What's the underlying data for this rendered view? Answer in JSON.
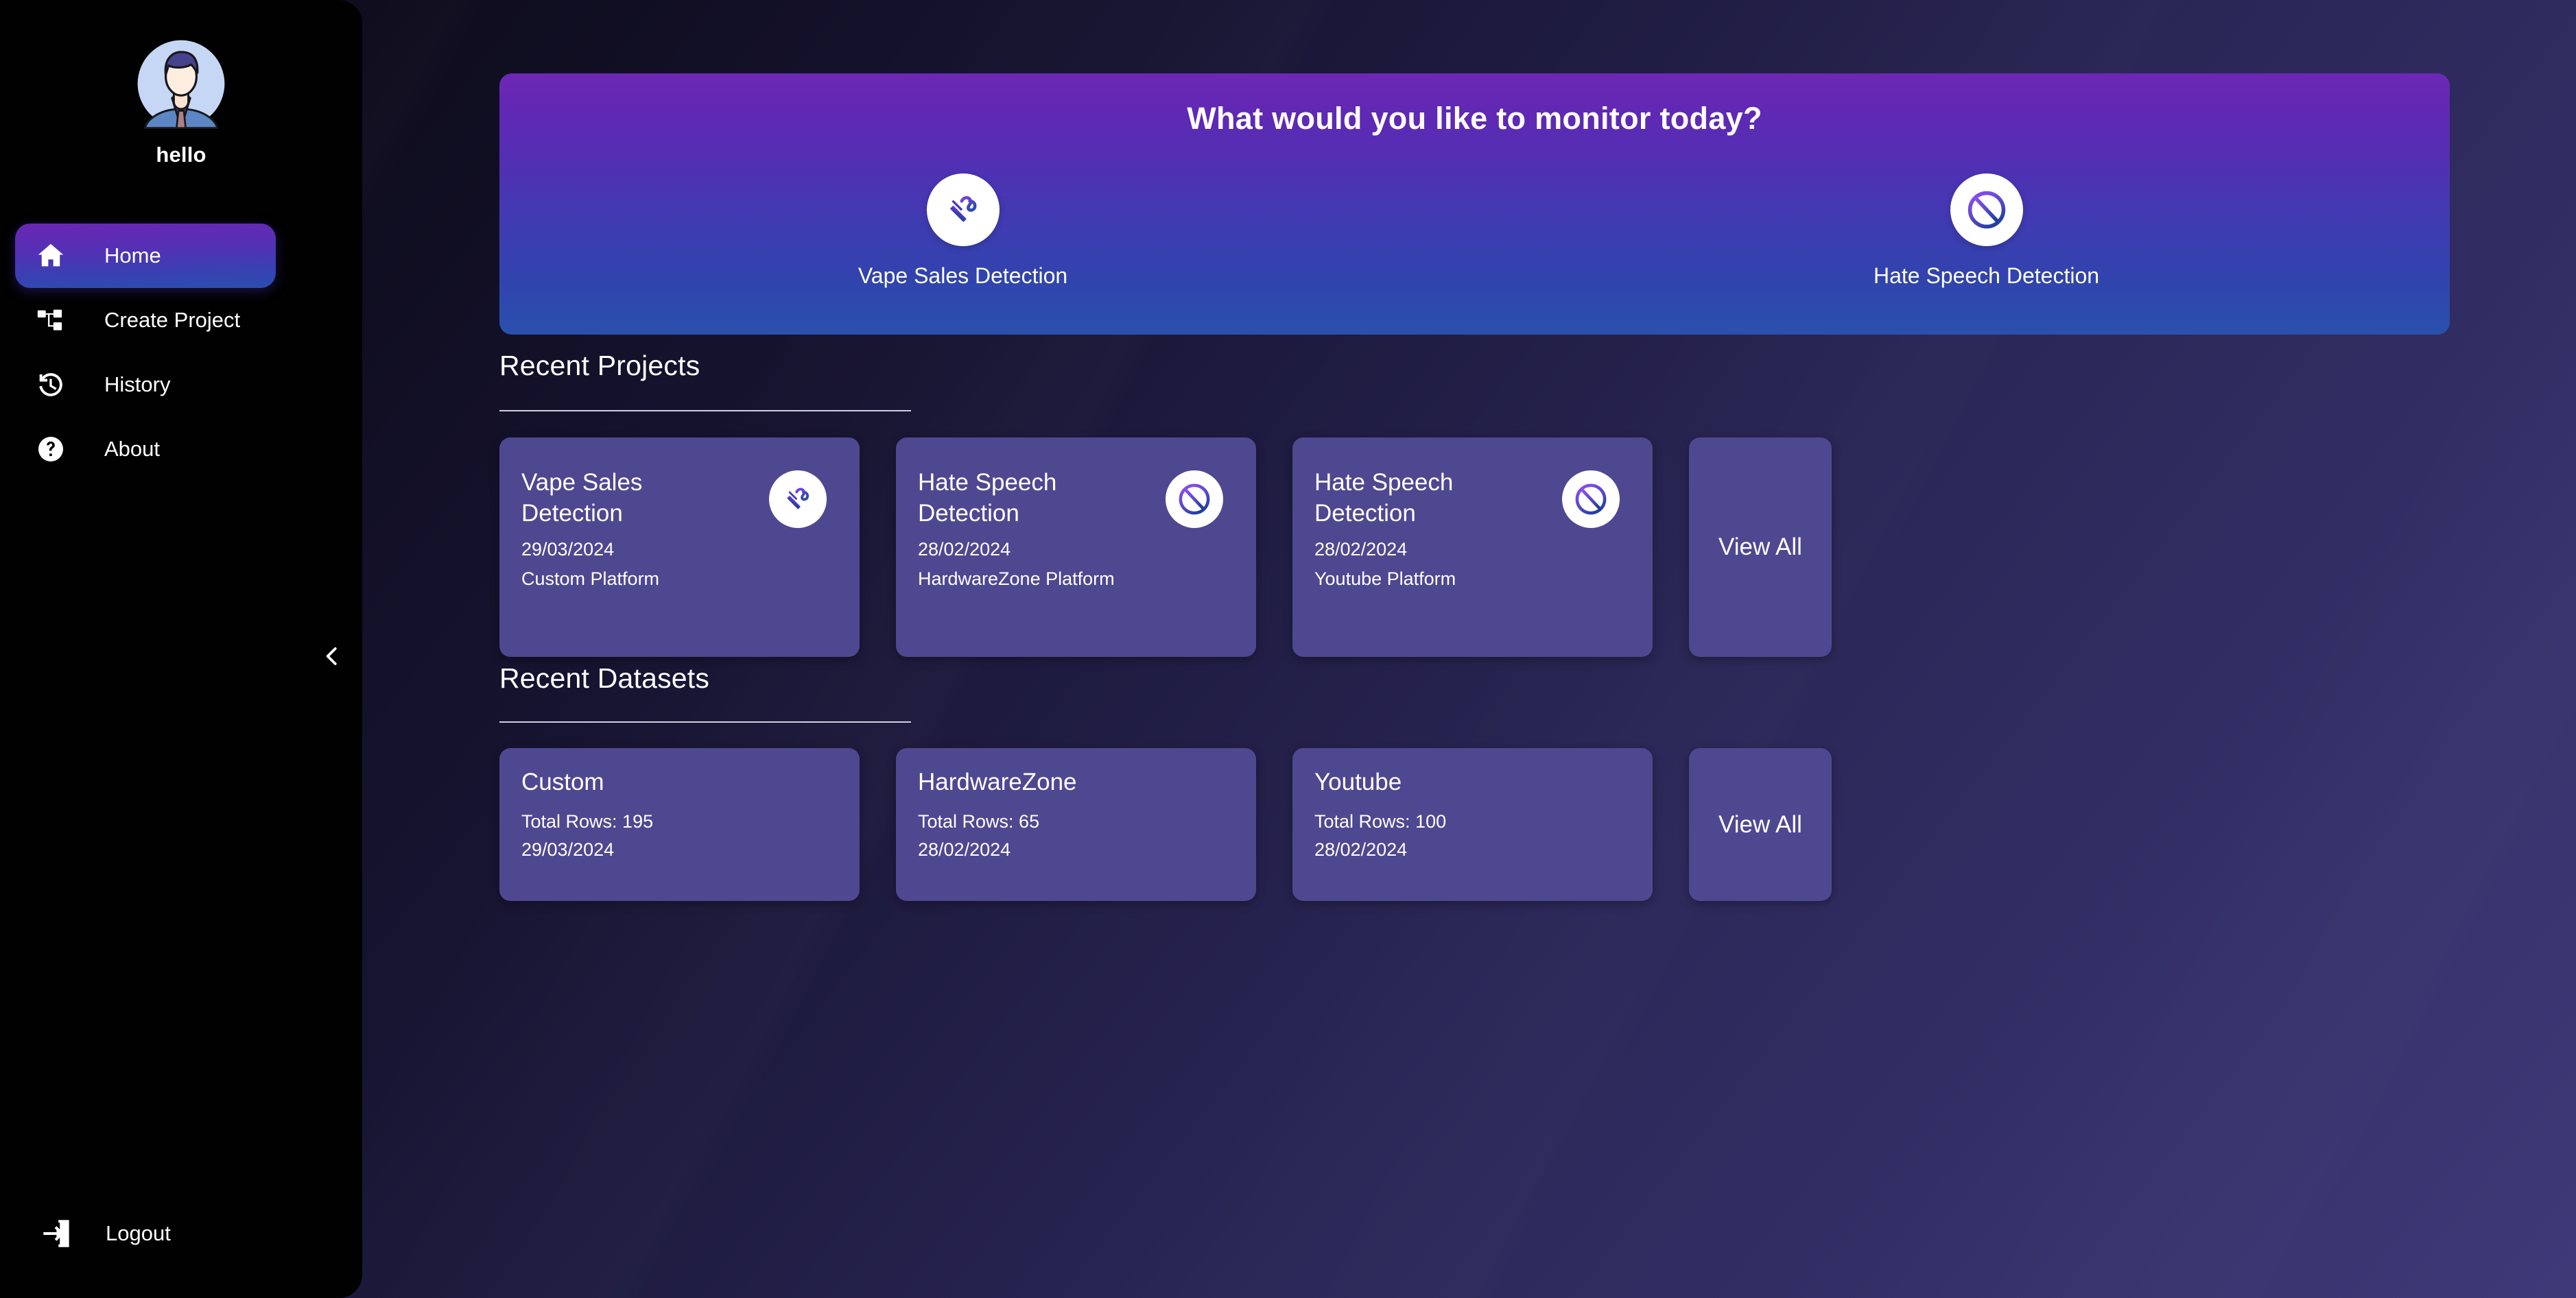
{
  "sidebar": {
    "avatar_icon": "user-avatar-businessman",
    "user_name": "hello",
    "items": [
      {
        "label": "Home",
        "icon": "home-icon",
        "active": true
      },
      {
        "label": "Create Project",
        "icon": "account-tree-icon",
        "active": false
      },
      {
        "label": "History",
        "icon": "history-clock-icon",
        "active": false
      },
      {
        "label": "About",
        "icon": "help-circle-icon",
        "active": false
      }
    ],
    "logout": {
      "label": "Logout",
      "icon": "logout-icon"
    },
    "collapse_icon": "chevron-left-icon"
  },
  "banner": {
    "title": "What would you like to monitor today?",
    "gradient_from": "#6d28b5",
    "gradient_to": "#2a50ad",
    "options": [
      {
        "label": "Vape Sales Detection",
        "icon": "vape-smoke-icon"
      },
      {
        "label": "Hate Speech Detection",
        "icon": "prohibition-sign-icon"
      }
    ]
  },
  "recent_projects": {
    "heading": "Recent Projects",
    "view_all_label": "View All",
    "cards": [
      {
        "title": "Vape Sales Detection",
        "date": "29/03/2024",
        "platform": "Custom Platform",
        "icon": "vape-smoke-icon"
      },
      {
        "title": "Hate Speech Detection",
        "date": "28/02/2024",
        "platform": "HardwareZone Platform",
        "icon": "prohibition-sign-icon"
      },
      {
        "title": "Hate Speech Detection",
        "date": "28/02/2024",
        "platform": "Youtube Platform",
        "icon": "prohibition-sign-icon"
      }
    ]
  },
  "recent_datasets": {
    "heading": "Recent Datasets",
    "view_all_label": "View All",
    "cards": [
      {
        "title": "Custom",
        "rows": "Total Rows: 195",
        "date": "29/03/2024"
      },
      {
        "title": "HardwareZone",
        "rows": "Total Rows: 65",
        "date": "28/02/2024"
      },
      {
        "title": "Youtube",
        "rows": "Total Rows: 100",
        "date": "28/02/2024"
      }
    ]
  },
  "colors": {
    "card_bg": "#4e4891",
    "sidebar_bg": "#010101",
    "accent_purple": "#6d28b5",
    "accent_blue": "#2a50ad"
  }
}
